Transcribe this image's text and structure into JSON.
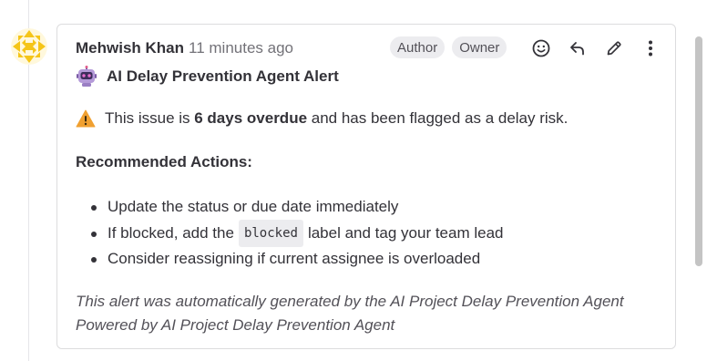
{
  "note": {
    "author": "Mehwish Khan",
    "timestamp": "11 minutes ago",
    "badges": [
      "Author",
      "Owner"
    ],
    "actions": [
      {
        "name": "emoji-reaction",
        "icon": "smiley-icon"
      },
      {
        "name": "reply",
        "icon": "reply-arrow-icon"
      },
      {
        "name": "edit",
        "icon": "pencil-icon"
      },
      {
        "name": "more-actions",
        "icon": "kebab-menu-icon"
      }
    ],
    "title": "AI Delay Prevention Agent Alert",
    "title_icon": "robot-icon",
    "alert": {
      "icon": "warning-icon",
      "prefix": "This issue is ",
      "emphasis": "6 days overdue",
      "suffix": " and has been flagged as a delay risk."
    },
    "recommended_heading": "Recommended Actions:",
    "items": [
      {
        "text": "Update the status or due date immediately"
      },
      {
        "pre": "If blocked, add the",
        "code": "blocked",
        "post": "label and tag your team lead"
      },
      {
        "text": "Consider reassigning if current assignee is overloaded"
      }
    ],
    "footer": "This alert was automatically generated by the AI Project Delay Prevention Agent Powered by AI Project Delay Prevention Agent"
  },
  "colors": {
    "text": "#333238",
    "muted": "#737278",
    "badge_bg": "#ececef",
    "border": "#dcdcde",
    "warning": "#f0a030",
    "avatar": "#f5c518"
  }
}
